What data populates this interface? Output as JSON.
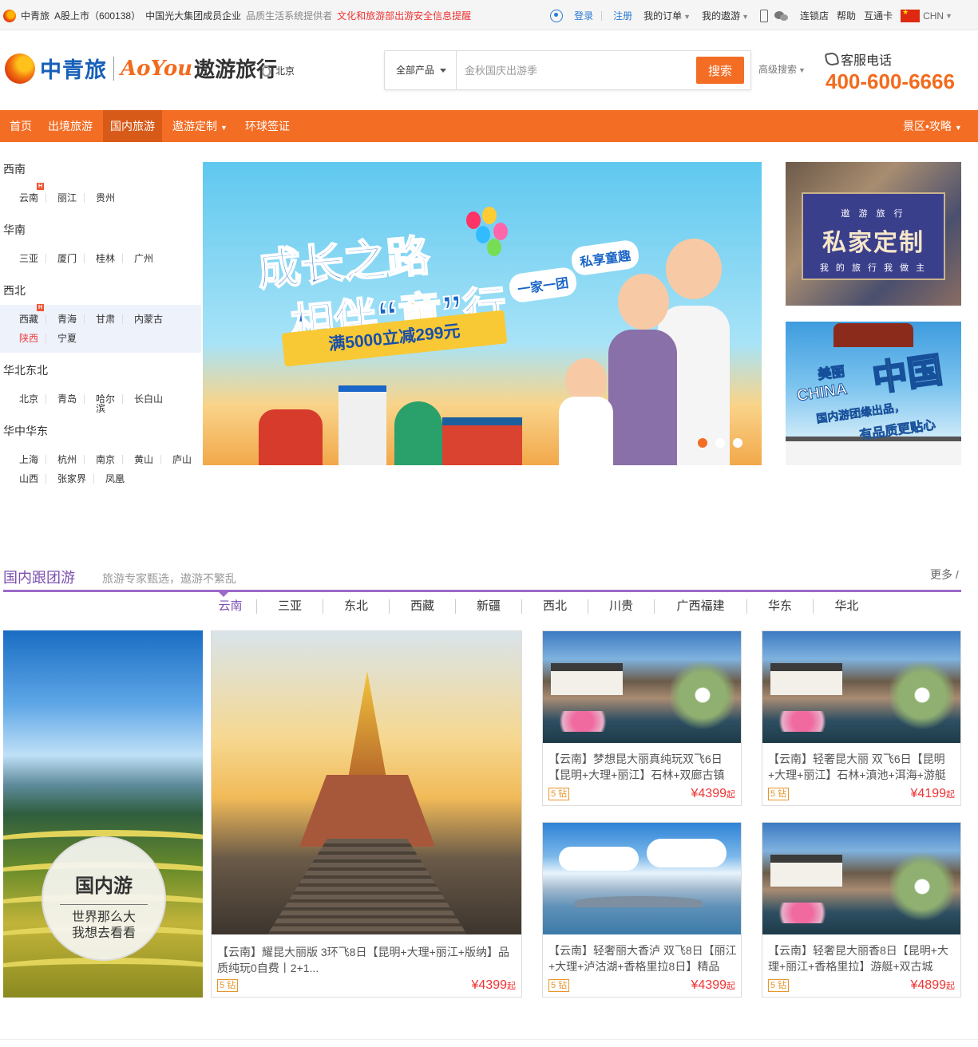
{
  "topbar": {
    "company": "中青旅",
    "stock": "A股上市（600138）",
    "group": "中国光大集团成员企业",
    "provider": "品质生活系统提供者",
    "notice": "文化和旅游部出游安全信息提醒",
    "login": "登录",
    "register": "注册",
    "my_orders": "我的订单",
    "my_aoyou": "我的遨游",
    "stores": "连锁店",
    "help": "帮助",
    "card": "互通卡",
    "lang": "CHN"
  },
  "header": {
    "logo_cn": "中青旅",
    "logo_aoyou": "AoYou",
    "logo_aoyou_cn": "遨游旅行",
    "location": "北京",
    "search": {
      "category": "全部产品",
      "placeholder": "金秋国庆出游季",
      "button": "搜索"
    },
    "advanced": "高级搜索",
    "hotline_label": "客服电话",
    "hotline_number": "400-600-6666"
  },
  "nav": {
    "items": [
      "首页",
      "出境旅游",
      "国内旅游",
      "遨游定制",
      "环球签证"
    ],
    "right": "景区•攻略"
  },
  "sidebar": {
    "regions": [
      {
        "name": "西南",
        "cities": [
          "云南",
          "丽江",
          "贵州"
        ]
      },
      {
        "name": "华南",
        "cities": [
          "三亚",
          "厦门",
          "桂林",
          "广州"
        ]
      },
      {
        "name": "西北",
        "cities": [
          "西藏",
          "青海",
          "甘肃",
          "内蒙古",
          "陕西",
          "宁夏"
        ]
      },
      {
        "name": "华北东北",
        "cities": [
          "北京",
          "青岛",
          "哈尔滨",
          "长白山"
        ]
      },
      {
        "name": "华中华东",
        "cities": [
          "上海",
          "杭州",
          "南京",
          "黄山",
          "庐山",
          "山西",
          "张家界",
          "凤凰"
        ]
      }
    ],
    "hot_badge": "H"
  },
  "banner": {
    "line1": "成长之路",
    "line2_a": "相伴“",
    "line2_b": "童",
    "line2_c": "”行",
    "offer": "满5000立减299元",
    "bubble1": "私享童趣",
    "bubble2": "一家一团"
  },
  "ad_custom": {
    "top": "遨 游 旅 行",
    "main": "私家定制",
    "sub": "我 的 旅 行 我 做 主"
  },
  "ad_china": {
    "cn_small": "美丽",
    "cn_big": "中国",
    "en": "CHINA",
    "sub1": "国内游团缘出品，",
    "sub2": "有品质更贴心"
  },
  "section": {
    "title": "国内跟团游",
    "subtitle": "旅游专家甄选，遨游不繁乱",
    "more": "更多 /",
    "tabs": [
      "云南",
      "三亚",
      "东北",
      "西藏",
      "新疆",
      "西北",
      "川贵",
      "广西福建",
      "华东",
      "华北"
    ]
  },
  "poster": {
    "title": "国内游",
    "line1": "世界那么大",
    "line2": "我想去看看"
  },
  "products": [
    {
      "title": "【云南】耀昆大丽版 3环飞8日【昆明+大理+丽江+版纳】品质纯玩0自费丨2+1...",
      "tag": "5 钻",
      "price": "¥4399",
      "unit": "起"
    },
    {
      "title": "【云南】梦想昆大丽真纯玩双飞6日【昆明+大理+丽江】石林+双廊古镇",
      "tag": "5 钻",
      "price": "¥4399",
      "unit": "起"
    },
    {
      "title": "【云南】轻奢昆大丽 双飞6日【昆明+大理+丽江】石林+滇池+洱海+游艇",
      "tag": "5 钻",
      "price": "¥4199",
      "unit": "起"
    },
    {
      "title": "【云南】轻奢丽大香泸 双飞8日【丽江+大理+泸沽湖+香格里拉8日】精品",
      "tag": "5 钻",
      "price": "¥4399",
      "unit": "起"
    },
    {
      "title": "【云南】轻奢昆大丽香8日【昆明+大理+丽江+香格里拉】游艇+双古城",
      "tag": "5 钻",
      "price": "¥4899",
      "unit": "起"
    }
  ]
}
